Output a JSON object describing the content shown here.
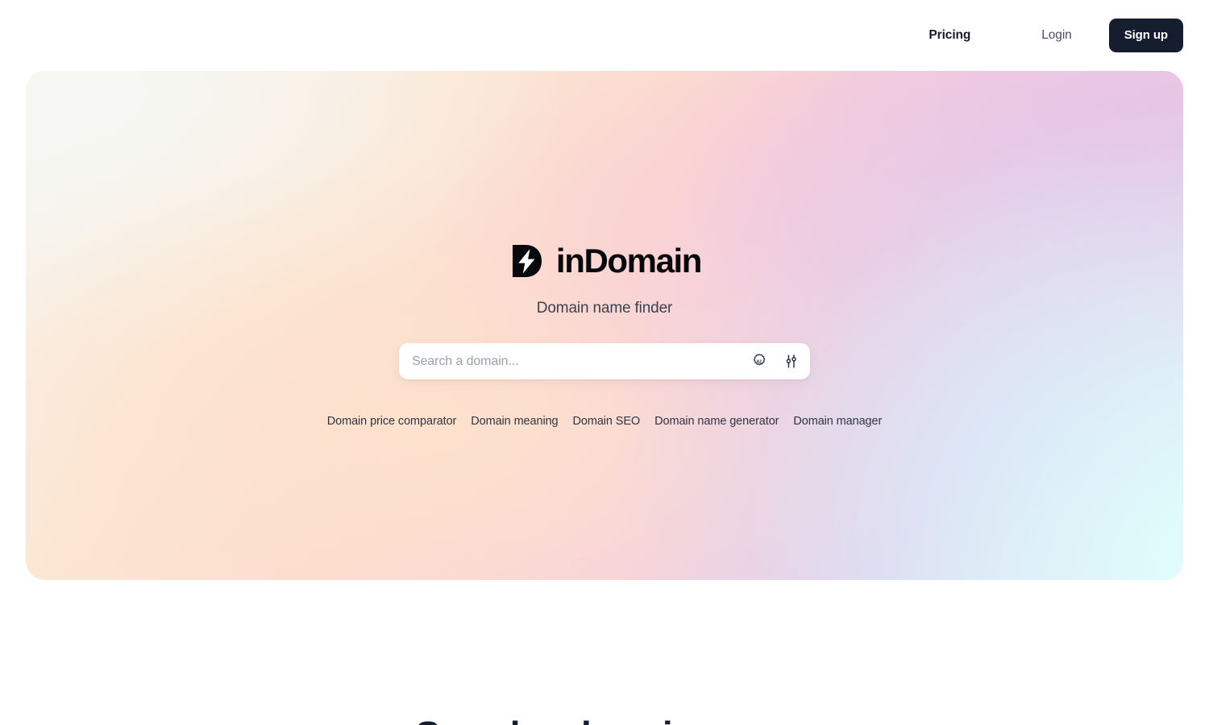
{
  "nav": {
    "pricing_label": "Pricing",
    "login_label": "Login",
    "signup_label": "Sign up"
  },
  "hero": {
    "logo_word": "inDomain",
    "logo_mark_icon": "lightning-bolt-d-logo-icon",
    "tagline": "Domain name finder",
    "search": {
      "placeholder": "Search a domain...",
      "value": "",
      "ai_icon": "ai-badge-icon",
      "filters_icon": "sliders-icon"
    },
    "quick_links": [
      {
        "label": "Domain price comparator"
      },
      {
        "label": "Domain meaning"
      },
      {
        "label": "Domain SEO"
      },
      {
        "label": "Domain name generator"
      },
      {
        "label": "Domain manager"
      }
    ]
  },
  "below_fold": {
    "section_heading": "Search a domain name"
  },
  "colors": {
    "brand_dark": "#161d2f",
    "text_primary": "#181c2a",
    "text_muted": "#4b5266",
    "placeholder": "#9a9fae",
    "card_white": "#ffffff",
    "gradient_top_left": "#f6f7f3",
    "gradient_peach": "#fbe7d4",
    "gradient_pink": "#f6cfdd",
    "gradient_lavender": "#e3cfe9",
    "gradient_mint": "#e4f6f6"
  }
}
